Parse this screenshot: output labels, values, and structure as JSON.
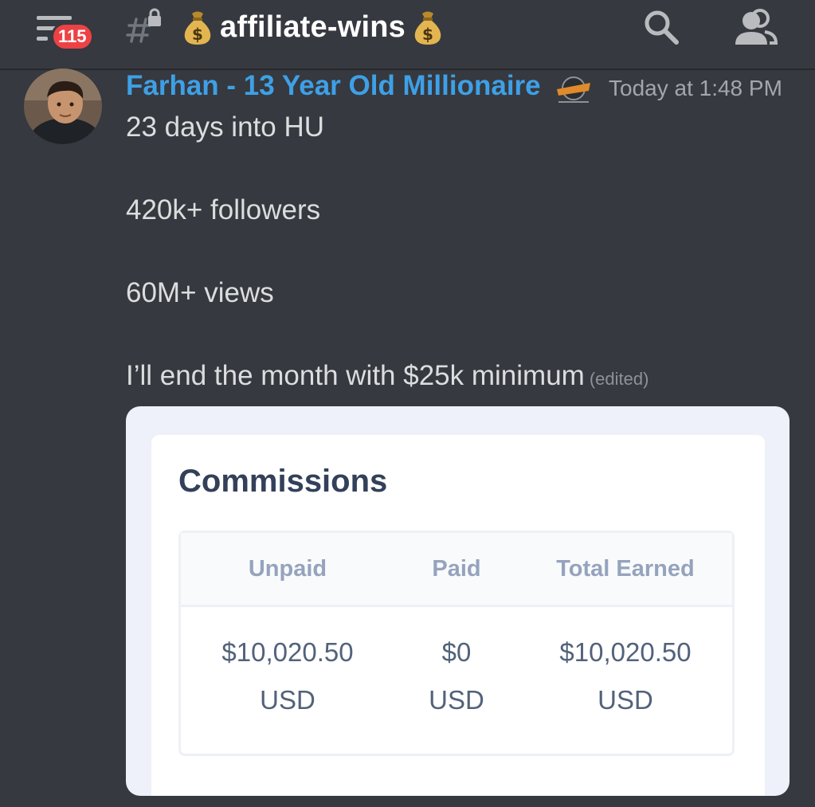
{
  "header": {
    "notification_count": "115",
    "channel_name": "affiliate-wins",
    "icons": [
      "hamburger-menu-icon",
      "locked-channel-icon",
      "money-bag-icon",
      "search-icon",
      "members-icon"
    ]
  },
  "message": {
    "author": "Farhan - 13 Year Old Millionaire",
    "timestamp": "Today at 1:48 PM",
    "lines": [
      "23 days into HU",
      "420k+ followers",
      "60M+ views",
      "I’ll end the month with $25k minimum"
    ],
    "edited_label": "(edited)"
  },
  "attachment": {
    "title": "Commissions",
    "columns": [
      "Unpaid",
      "Paid",
      "Total Earned"
    ],
    "rows": [
      {
        "amount": "$10,020.50",
        "currency": "USD"
      },
      {
        "amount": "$0",
        "currency": "USD"
      },
      {
        "amount": "$10,020.50",
        "currency": "USD"
      }
    ]
  },
  "colors": {
    "background": "#36393f",
    "username": "#3ea0e6",
    "badge": "#ed4245",
    "panel_title": "#32405a",
    "table_header": "#95a3bd",
    "table_value": "#52627b"
  }
}
